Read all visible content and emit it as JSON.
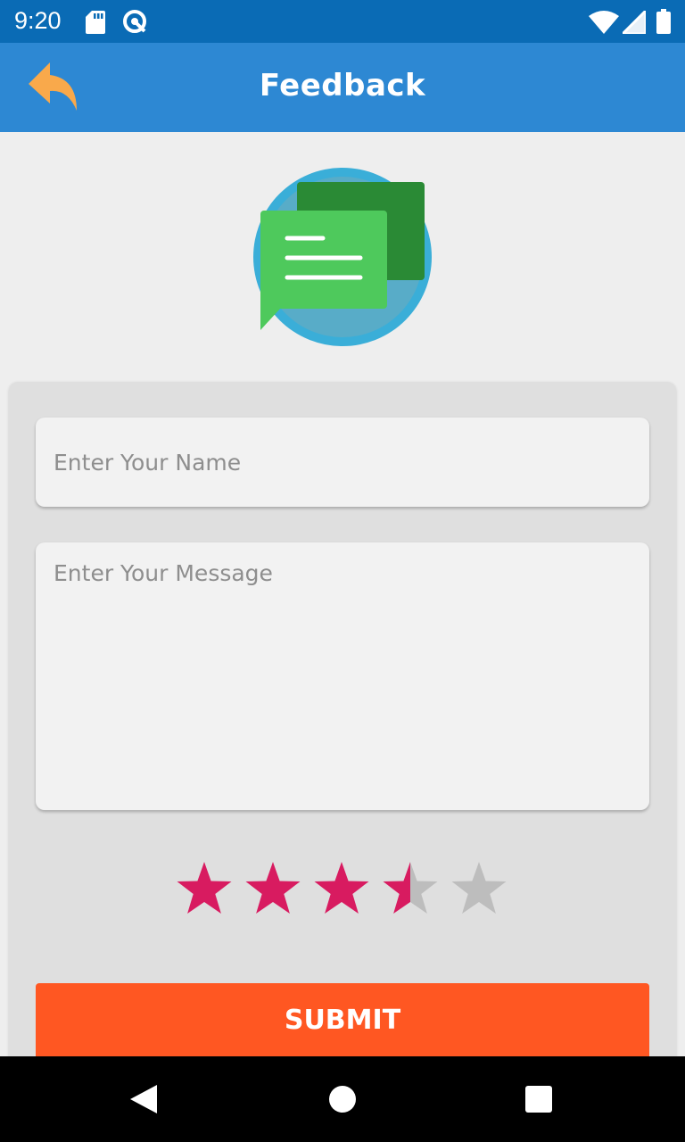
{
  "status_bar": {
    "time": "9:20",
    "icons": [
      "sd-card-icon",
      "data-saver-icon",
      "wifi-icon",
      "cell-signal-icon",
      "battery-icon"
    ]
  },
  "toolbar": {
    "title": "Feedback",
    "back_icon": "reply-arrow-icon",
    "back_icon_color": "#f9a94b",
    "background": "#2d88d3"
  },
  "illustration": {
    "icon": "chat-bubbles-icon",
    "colors": [
      "#3aaed8",
      "#2a8a35",
      "#4ec95c"
    ]
  },
  "form": {
    "name_placeholder": "Enter Your Name",
    "name_value": "",
    "message_placeholder": "Enter Your Message",
    "message_value": ""
  },
  "rating": {
    "value": 3.5,
    "max": 5,
    "filled_color": "#d81b60",
    "empty_color": "#bdbdbd"
  },
  "submit": {
    "label": "SUBMIT",
    "color": "#ff5722"
  },
  "nav_bar": {
    "icons": [
      "nav-back-icon",
      "nav-home-icon",
      "nav-recents-icon"
    ]
  }
}
